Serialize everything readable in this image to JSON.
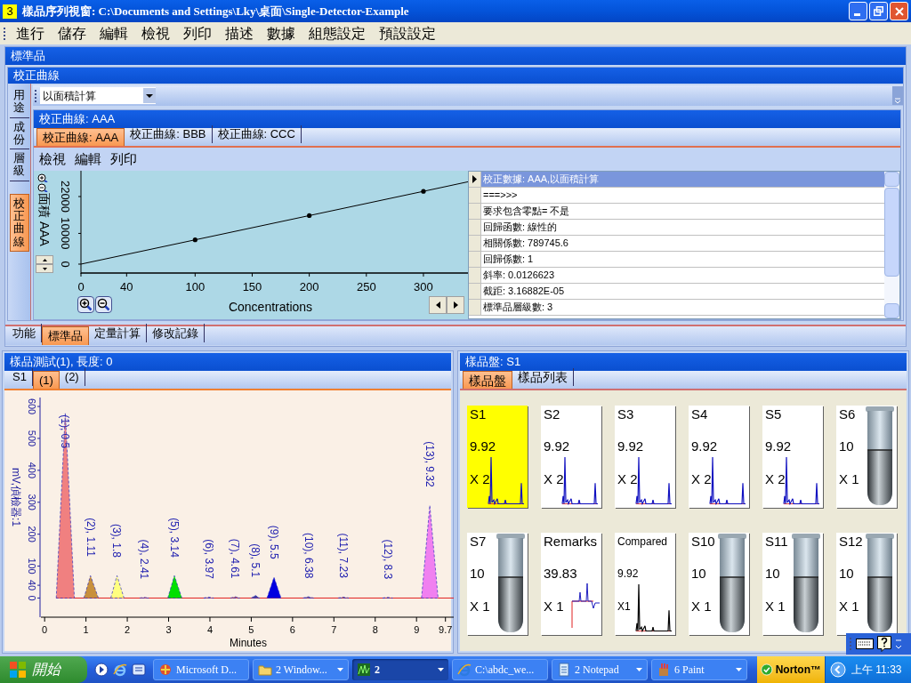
{
  "window": {
    "title": "樣品序列視窗: C:\\Documents and Settings\\Lky\\桌面\\Single-Detector-Example",
    "badge": "3"
  },
  "menu": [
    "進行",
    "儲存",
    "編輯",
    "檢視",
    "列印",
    "描述",
    "數據",
    "組態設定",
    "預設設定"
  ],
  "standards_panel": {
    "title": "標準品",
    "calibration_panel": {
      "title": "校正曲線",
      "side_tabs": [
        {
          "label": "用途",
          "selected": false
        },
        {
          "label": "成份",
          "selected": false
        },
        {
          "label": "層級",
          "selected": false
        },
        {
          "label": "校正曲線",
          "selected": true
        }
      ],
      "calc_mode": {
        "value": "以面積計算"
      },
      "curve_panel": {
        "title": "校正曲線: AAA",
        "tabs": [
          {
            "label": "校正曲線: AAA",
            "selected": true
          },
          {
            "label": "校正曲線: BBB",
            "selected": false
          },
          {
            "label": "校正曲線: CCC",
            "selected": false
          }
        ],
        "menu": [
          "檢視",
          "編輯",
          "列印"
        ],
        "chart_data": {
          "type": "line",
          "xlabel": "Concentrations",
          "ylabel": "面積 AAA",
          "x": [
            0,
            100,
            200,
            300,
            339
          ],
          "xlim": [
            0,
            339
          ],
          "ylim": [
            -2900,
            30400
          ],
          "series": [
            {
              "values": [
                0,
                7900,
                15800,
                23700,
                26800
              ]
            }
          ],
          "xticks": [
            0,
            40,
            100,
            150,
            200,
            250,
            300
          ],
          "yticks": [
            0,
            10000,
            22000
          ]
        },
        "details": [
          {
            "text": "校正數據: AAA,以面積計算",
            "selected": true
          },
          {
            "text": "===>>>",
            "selected": false
          },
          {
            "text": "要求包含零點= 不是",
            "selected": false
          },
          {
            "text": "回歸函數: 線性的",
            "selected": false
          },
          {
            "text": "相關係數: 789745.6",
            "selected": false
          },
          {
            "text": "回歸係數: 1",
            "selected": false
          },
          {
            "text": "斜率: 0.0126623",
            "selected": false
          },
          {
            "text": "截距: 3.16882E-05",
            "selected": false
          },
          {
            "text": "標準品層級數: 3",
            "selected": false
          }
        ]
      }
    }
  },
  "bottom_tabs": [
    {
      "label": "功能",
      "selected": false
    },
    {
      "label": "標準品",
      "selected": true
    },
    {
      "label": "定量計算",
      "selected": false
    },
    {
      "label": "修改記錄",
      "selected": false
    }
  ],
  "test_panel": {
    "title": "樣品測試(1), 長度: 0",
    "tabs": [
      {
        "label": "S1",
        "selected": false
      },
      {
        "label": "(1)",
        "selected": true
      },
      {
        "label": "(2)",
        "selected": false
      }
    ],
    "chart_data": {
      "type": "area",
      "xlabel": "Minutes",
      "ylabel": "mV,偵檢器:1",
      "xlim": [
        -0.09,
        9.9
      ],
      "ylim": [
        -60,
        628
      ],
      "xticks": [
        0,
        1,
        2,
        3,
        4,
        5,
        6,
        7,
        8,
        9,
        9.7
      ],
      "yticks": [
        0,
        40,
        100,
        200,
        300,
        400,
        500,
        600
      ],
      "x": [
        0.28,
        0.5,
        0.72,
        0.95,
        1.11,
        1.3,
        1.6,
        1.75,
        1.92,
        2.3,
        2.41,
        2.52,
        2.98,
        3.14,
        3.32,
        3.85,
        3.97,
        4.09,
        4.5,
        4.61,
        4.72,
        5.0,
        5.1,
        5.2,
        5.38,
        5.55,
        5.72,
        6.25,
        6.38,
        6.51,
        7.1,
        7.23,
        7.36,
        8.18,
        8.3,
        8.42,
        9.12,
        9.32,
        9.52
      ],
      "series": [
        {
          "color": "#f08080",
          "values": [
            0,
            580,
            0,
            null,
            null,
            null,
            null,
            null,
            null,
            null,
            null,
            null,
            null,
            null,
            null,
            null,
            null,
            null,
            null,
            null,
            null,
            null,
            null,
            null,
            null,
            null,
            null,
            null,
            null,
            null,
            null,
            null,
            null,
            null,
            null,
            null,
            null,
            null,
            null
          ]
        },
        {
          "color": "#c8903c",
          "values": [
            null,
            null,
            null,
            0,
            70,
            0,
            null,
            null,
            null,
            null,
            null,
            null,
            null,
            null,
            null,
            null,
            null,
            null,
            null,
            null,
            null,
            null,
            null,
            null,
            null,
            null,
            null,
            null,
            null,
            null,
            null,
            null,
            null,
            null,
            null,
            null,
            null,
            null,
            null
          ]
        },
        {
          "color": "#ffff80",
          "values": [
            null,
            null,
            null,
            null,
            null,
            null,
            0,
            70,
            0,
            null,
            null,
            null,
            null,
            null,
            null,
            null,
            null,
            null,
            null,
            null,
            null,
            null,
            null,
            null,
            null,
            null,
            null,
            null,
            null,
            null,
            null,
            null,
            null,
            null,
            null,
            null,
            null,
            null,
            null
          ]
        },
        {
          "color": "#e07070",
          "values": [
            null,
            null,
            null,
            null,
            null,
            null,
            null,
            null,
            null,
            0,
            2,
            0,
            null,
            null,
            null,
            null,
            null,
            null,
            null,
            null,
            null,
            null,
            null,
            null,
            null,
            null,
            null,
            null,
            null,
            null,
            null,
            null,
            null,
            null,
            null,
            null,
            null,
            null,
            null
          ]
        },
        {
          "color": "#00e000",
          "values": [
            null,
            null,
            null,
            null,
            null,
            null,
            null,
            null,
            null,
            null,
            null,
            null,
            0,
            70,
            0,
            null,
            null,
            null,
            null,
            null,
            null,
            null,
            null,
            null,
            null,
            null,
            null,
            null,
            null,
            null,
            null,
            null,
            null,
            null,
            null,
            null,
            null,
            null,
            null
          ]
        },
        {
          "color": "#8080c0",
          "values": [
            null,
            null,
            null,
            null,
            null,
            null,
            null,
            null,
            null,
            null,
            null,
            null,
            null,
            null,
            null,
            0,
            3,
            0,
            null,
            null,
            null,
            null,
            null,
            null,
            null,
            null,
            null,
            null,
            null,
            null,
            null,
            null,
            null,
            null,
            null,
            null,
            null,
            null,
            null
          ]
        },
        {
          "color": "#c06060",
          "values": [
            null,
            null,
            null,
            null,
            null,
            null,
            null,
            null,
            null,
            null,
            null,
            null,
            null,
            null,
            null,
            null,
            null,
            null,
            0,
            4,
            0,
            null,
            null,
            null,
            null,
            null,
            null,
            null,
            null,
            null,
            null,
            null,
            null,
            null,
            null,
            null,
            null,
            null,
            null
          ]
        },
        {
          "color": "#4040a0",
          "values": [
            null,
            null,
            null,
            null,
            null,
            null,
            null,
            null,
            null,
            null,
            null,
            null,
            null,
            null,
            null,
            null,
            null,
            null,
            null,
            null,
            null,
            0,
            8,
            0,
            null,
            null,
            null,
            null,
            null,
            null,
            null,
            null,
            null,
            null,
            null,
            null,
            null,
            null,
            null
          ]
        },
        {
          "color": "#0000e0",
          "values": [
            null,
            null,
            null,
            null,
            null,
            null,
            null,
            null,
            null,
            null,
            null,
            null,
            null,
            null,
            null,
            null,
            null,
            null,
            null,
            null,
            null,
            null,
            null,
            null,
            0,
            65,
            0,
            null,
            null,
            null,
            null,
            null,
            null,
            null,
            null,
            null,
            null,
            null,
            null
          ]
        },
        {
          "color": "#6060a0",
          "values": [
            null,
            null,
            null,
            null,
            null,
            null,
            null,
            null,
            null,
            null,
            null,
            null,
            null,
            null,
            null,
            null,
            null,
            null,
            null,
            null,
            null,
            null,
            null,
            null,
            null,
            null,
            null,
            0,
            4,
            0,
            null,
            null,
            null,
            null,
            null,
            null,
            null,
            null,
            null
          ]
        },
        {
          "color": "#a05050",
          "values": [
            null,
            null,
            null,
            null,
            null,
            null,
            null,
            null,
            null,
            null,
            null,
            null,
            null,
            null,
            null,
            null,
            null,
            null,
            null,
            null,
            null,
            null,
            null,
            null,
            null,
            null,
            null,
            null,
            null,
            null,
            0,
            3,
            0,
            null,
            null,
            null,
            null,
            null,
            null
          ]
        },
        {
          "color": "#a05050",
          "values": [
            null,
            null,
            null,
            null,
            null,
            null,
            null,
            null,
            null,
            null,
            null,
            null,
            null,
            null,
            null,
            null,
            null,
            null,
            null,
            null,
            null,
            null,
            null,
            null,
            null,
            null,
            null,
            null,
            null,
            null,
            null,
            null,
            null,
            0,
            2,
            0,
            null,
            null,
            null
          ]
        },
        {
          "color": "#f080f0",
          "values": [
            null,
            null,
            null,
            null,
            null,
            null,
            null,
            null,
            null,
            null,
            null,
            null,
            null,
            null,
            null,
            null,
            null,
            null,
            null,
            null,
            null,
            null,
            null,
            null,
            null,
            null,
            null,
            null,
            null,
            null,
            null,
            null,
            null,
            null,
            null,
            null,
            0,
            290,
            0
          ]
        }
      ],
      "ref_lines": [
        {
          "axis": "y",
          "value": 0,
          "color": "#e02020"
        }
      ],
      "annotations": [
        {
          "x": 0.5,
          "y": 580,
          "text": "(1), 0.5"
        },
        {
          "x": 1.11,
          "y": 70,
          "text": "(2), 1.11"
        },
        {
          "x": 1.75,
          "y": 70,
          "text": "(3), 1.8"
        },
        {
          "x": 2.41,
          "y": 2,
          "text": "(4), 2.41"
        },
        {
          "x": 3.14,
          "y": 70,
          "text": "(5), 3.14"
        },
        {
          "x": 3.97,
          "y": 3,
          "text": "(6), 3.97"
        },
        {
          "x": 4.61,
          "y": 4,
          "text": "(7), 4.61"
        },
        {
          "x": 5.1,
          "y": 8,
          "text": "(8), 5.1"
        },
        {
          "x": 5.55,
          "y": 65,
          "text": "(9), 5.5"
        },
        {
          "x": 6.38,
          "y": 4,
          "text": "(10), 6.38"
        },
        {
          "x": 7.23,
          "y": 3,
          "text": "(11), 7.23"
        },
        {
          "x": 8.3,
          "y": 2,
          "text": "(12), 8.3"
        },
        {
          "x": 9.32,
          "y": 290,
          "text": "(13), 9.32"
        }
      ]
    }
  },
  "tray_panel": {
    "title": "樣品盤: S1",
    "tabs": [
      {
        "label": "樣品盤",
        "selected": true
      },
      {
        "label": "樣品列表",
        "selected": false
      }
    ],
    "samples": [
      {
        "kind": "chromatogram",
        "name": "S1",
        "value": "9.92",
        "count": "X 2",
        "selected": true
      },
      {
        "kind": "chromatogram",
        "name": "S2",
        "value": "9.92",
        "count": "X 2",
        "selected": false
      },
      {
        "kind": "chromatogram",
        "name": "S3",
        "value": "9.92",
        "count": "X 2",
        "selected": false
      },
      {
        "kind": "chromatogram",
        "name": "S4",
        "value": "9.92",
        "count": "X 2",
        "selected": false
      },
      {
        "kind": "chromatogram",
        "name": "S5",
        "value": "9.92",
        "count": "X 2",
        "selected": false
      },
      {
        "kind": "tube",
        "name": "S6",
        "value": "10",
        "count": "X 1",
        "selected": false
      },
      {
        "kind": "tube",
        "name": "S7",
        "value": "10",
        "count": "X 1",
        "selected": false
      },
      {
        "kind": "remarks",
        "name": "Remarks",
        "value": "39.83",
        "count": "X 1",
        "selected": false
      },
      {
        "kind": "compared",
        "name": "Compared",
        "value": "9.92",
        "count": "X1",
        "selected": false
      },
      {
        "kind": "tube",
        "name": "S10",
        "value": "10",
        "count": "X 1",
        "selected": false
      },
      {
        "kind": "tube",
        "name": "S11",
        "value": "10",
        "count": "X 1",
        "selected": false
      },
      {
        "kind": "tube",
        "name": "S12",
        "value": "10",
        "count": "X 1",
        "selected": false
      }
    ]
  },
  "taskbar": {
    "start": "開始",
    "tasks": [
      {
        "label": "Microsoft D...",
        "kind": "app",
        "grouped": false,
        "selected": false
      },
      {
        "label": "2 Window...",
        "kind": "folder",
        "grouped": true,
        "selected": false
      },
      {
        "label": "2",
        "kind": "chart",
        "grouped": true,
        "selected": true
      },
      {
        "label": "C:\\abdc_we...",
        "kind": "browser",
        "grouped": false,
        "selected": false
      },
      {
        "label": "2 Notepad",
        "kind": "notepad",
        "grouped": true,
        "selected": false
      },
      {
        "label": "6 Paint",
        "kind": "paint",
        "grouped": true,
        "selected": false
      }
    ],
    "tray_button": "Norton™",
    "clock": "上午 11:33"
  }
}
